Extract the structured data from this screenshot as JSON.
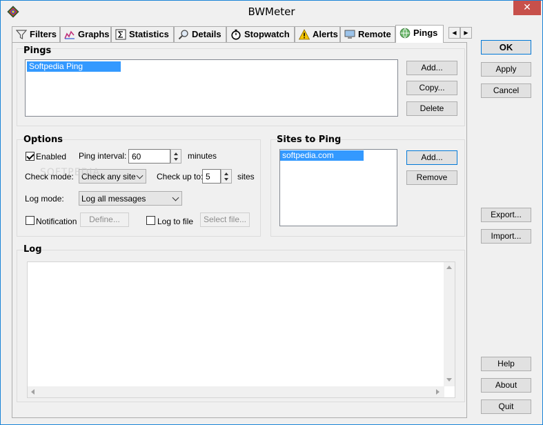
{
  "window": {
    "title": "BWMeter",
    "close_glyph": "✕"
  },
  "tabs": [
    {
      "label": "Filters",
      "icon": "filter-icon"
    },
    {
      "label": "Graphs",
      "icon": "graph-icon"
    },
    {
      "label": "Statistics",
      "icon": "sigma-icon"
    },
    {
      "label": "Details",
      "icon": "magnifier-icon"
    },
    {
      "label": "Stopwatch",
      "icon": "stopwatch-icon"
    },
    {
      "label": "Alerts",
      "icon": "warning-icon"
    },
    {
      "label": "Remote",
      "icon": "monitor-icon"
    },
    {
      "label": "Pings",
      "icon": "globe-icon",
      "active": true
    }
  ],
  "tab_scroll": {
    "left": "◀",
    "right": "▶"
  },
  "pings": {
    "title": "Pings",
    "items": [
      "Softpedia Ping"
    ],
    "add_label": "Add...",
    "copy_label": "Copy...",
    "delete_label": "Delete"
  },
  "options": {
    "title": "Options",
    "enabled_label": "Enabled",
    "enabled_checked": true,
    "ping_interval_label": "Ping interval:",
    "ping_interval_value": "60",
    "ping_interval_unit": "minutes",
    "check_mode_label": "Check mode:",
    "check_mode_value": "Check any site",
    "check_up_to_label": "Check up to:",
    "check_up_to_value": "5",
    "check_up_to_unit": "sites",
    "log_mode_label": "Log mode:",
    "log_mode_value": "Log all messages",
    "notification_label": "Notification",
    "define_label": "Define...",
    "log_to_file_label": "Log to file",
    "select_file_label": "Select file..."
  },
  "sites": {
    "title": "Sites to Ping",
    "items": [
      "softpedia.com"
    ],
    "add_label": "Add...",
    "remove_label": "Remove"
  },
  "log": {
    "title": "Log"
  },
  "right_buttons": {
    "ok": "OK",
    "apply": "Apply",
    "cancel": "Cancel",
    "export": "Export...",
    "import": "Import...",
    "help": "Help",
    "about": "About",
    "quit": "Quit"
  },
  "watermark": "SOFTPEDIA",
  "colors": {
    "selection": "#3399ff",
    "close": "#c7504b",
    "accent_border": "#0078d7"
  }
}
